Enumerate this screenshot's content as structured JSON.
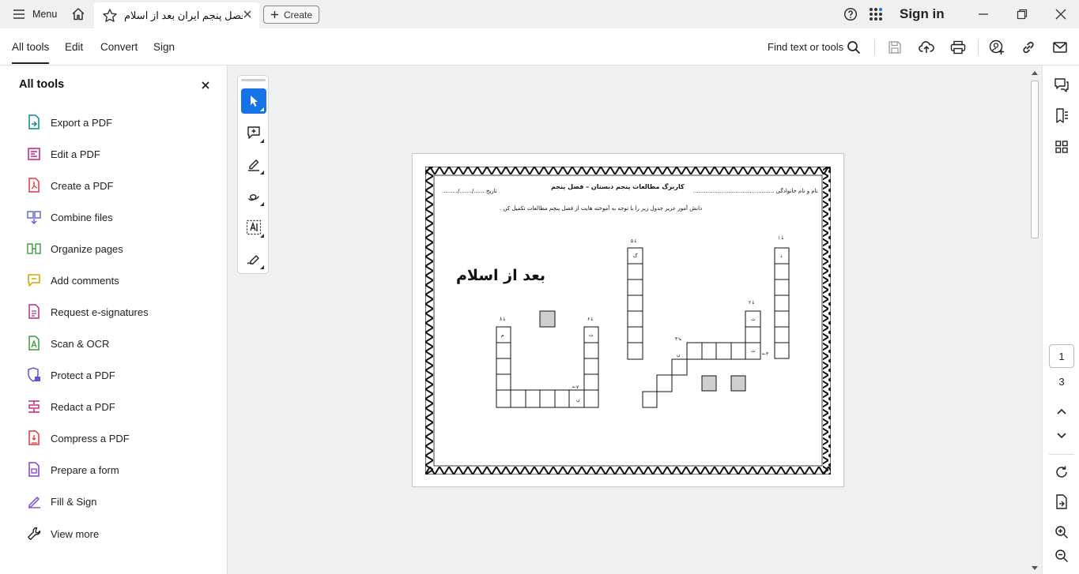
{
  "titlebar": {
    "menu_label": "Menu",
    "tab_title": "فصل پنجم ایران بعد از اسلام...",
    "create_label": "Create",
    "sign_in": "Sign in"
  },
  "toolbar": {
    "tabs": [
      "All tools",
      "Edit",
      "Convert",
      "Sign"
    ],
    "active_tab": "All tools",
    "find_label": "Find text or tools"
  },
  "left_panel": {
    "title": "All tools",
    "items": [
      {
        "label": "Export a PDF",
        "icon": "export-pdf-icon",
        "color": "#0f8a8f"
      },
      {
        "label": "Edit a PDF",
        "icon": "edit-pdf-icon",
        "color": "#c9207a"
      },
      {
        "label": "Create a PDF",
        "icon": "create-pdf-icon",
        "color": "#e0393e"
      },
      {
        "label": "Combine files",
        "icon": "combine-files-icon",
        "color": "#5b5fe3"
      },
      {
        "label": "Organize pages",
        "icon": "organize-pages-icon",
        "color": "#3c9a3c"
      },
      {
        "label": "Add comments",
        "icon": "add-comments-icon",
        "color": "#d9a400"
      },
      {
        "label": "Request e-signatures",
        "icon": "request-esignatures-icon",
        "color": "#b0308f"
      },
      {
        "label": "Scan & OCR",
        "icon": "scan-ocr-icon",
        "color": "#3c9a3c"
      },
      {
        "label": "Protect a PDF",
        "icon": "protect-pdf-icon",
        "color": "#6a4fd8"
      },
      {
        "label": "Redact a PDF",
        "icon": "redact-pdf-icon",
        "color": "#c9207a"
      },
      {
        "label": "Compress a PDF",
        "icon": "compress-pdf-icon",
        "color": "#e0393e"
      },
      {
        "label": "Prepare a form",
        "icon": "prepare-form-icon",
        "color": "#8a3fc8"
      },
      {
        "label": "Fill & Sign",
        "icon": "fill-sign-icon",
        "color": "#7a4fd8"
      }
    ],
    "view_more": "View more"
  },
  "page_nav": {
    "current_page": "1",
    "total_pages": "3"
  },
  "document": {
    "title": "کاربرگ مطالعات پنجم دبستان – فصل پنجم",
    "name_line": "نام و نام خانوادگی ..............................................",
    "date_line": "تاریخ   ....../......./.........",
    "instruction": "دانش آموز عزیز جدول زیر را با توجه به آموخته هایت از فصل پنجم مطالعات تکمیل کن .",
    "big_label": "بعد از اسلام",
    "grid_letters": {
      "col1_top": "د",
      "col2_top": "ت",
      "row3_end": "ت",
      "diag_start": "ن",
      "col5_top": "گ",
      "left_col_top": "ت",
      "left_col2_top": "م",
      "row7_end": "ن"
    },
    "clue_numbers": [
      "1",
      "2",
      "3",
      "4",
      "5",
      "6",
      "7",
      "8"
    ]
  },
  "colors": {
    "accent": "#1473e6",
    "app_bg": "#f0f0f0"
  }
}
